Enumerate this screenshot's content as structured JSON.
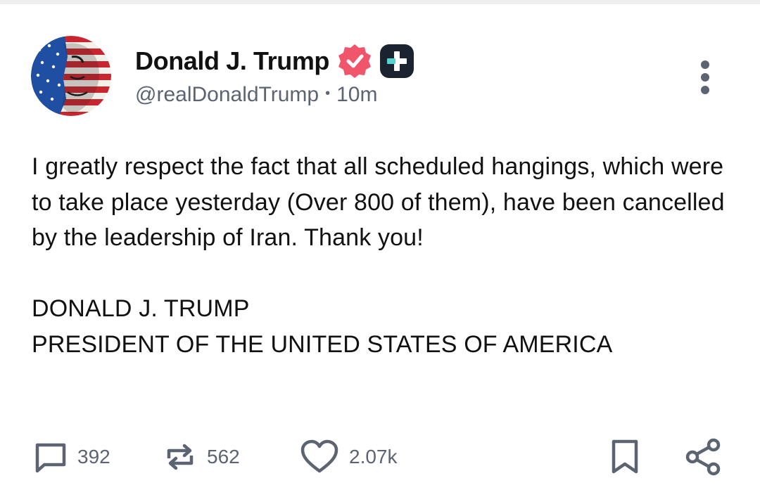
{
  "post": {
    "author": {
      "display_name": "Donald J. Trump",
      "handle": "@realDonaldTrump",
      "verified": true,
      "badge_color": "#f0556b",
      "plus_badge_color": "#1b2230",
      "plus_badge_accent": "#53d4cf"
    },
    "time_ago": "10m",
    "separator": "•",
    "body_paragraphs": [
      "I greatly respect the fact that all scheduled hangings, which were to take place yesterday (Over 800 of them), have been cancelled by the leadership of Iran. Thank you!",
      "DONALD J. TRUMP\nPRESIDENT OF THE UNITED STATES OF AMERICA"
    ],
    "stats": {
      "replies": "392",
      "retruths": "562",
      "likes": "2.07k"
    }
  },
  "icons": {
    "reply": "comment-icon",
    "retruth": "repost-icon",
    "like": "heart-icon",
    "bookmark": "bookmark-icon",
    "share": "share-icon",
    "more": "more-vertical-icon"
  },
  "colors": {
    "text": "#111111",
    "muted": "#5c6471",
    "icon": "#5c6471"
  }
}
